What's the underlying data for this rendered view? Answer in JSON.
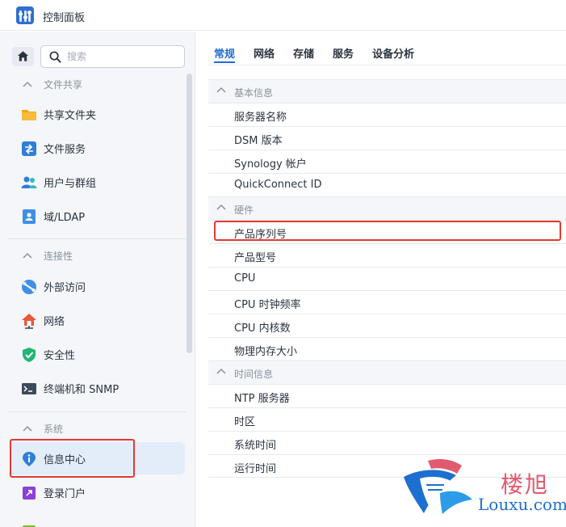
{
  "window": {
    "title": "控制面板"
  },
  "sidebar": {
    "search_placeholder": "搜索",
    "sections": [
      {
        "label": "文件共享"
      },
      {
        "label": "连接性"
      },
      {
        "label": "系统"
      }
    ],
    "items": [
      {
        "label": "共享文件夹",
        "icon": "folder-icon"
      },
      {
        "label": "文件服务",
        "icon": "file-services-icon"
      },
      {
        "label": "用户与群组",
        "icon": "users-icon"
      },
      {
        "label": "域/LDAP",
        "icon": "ldap-icon"
      },
      {
        "label": "外部访问",
        "icon": "external-access-icon"
      },
      {
        "label": "网络",
        "icon": "network-icon"
      },
      {
        "label": "安全性",
        "icon": "shield-icon"
      },
      {
        "label": "终端机和 SNMP",
        "icon": "terminal-icon"
      },
      {
        "label": "信息中心",
        "icon": "info-icon",
        "active": true
      },
      {
        "label": "登录门户",
        "icon": "login-portal-icon"
      }
    ]
  },
  "tabs": [
    {
      "label": "常规",
      "active": true
    },
    {
      "label": "网络"
    },
    {
      "label": "存储"
    },
    {
      "label": "服务"
    },
    {
      "label": "设备分析"
    }
  ],
  "info_table": {
    "groups": [
      {
        "label": "基本信息",
        "rows": [
          "服务器名称",
          "DSM 版本",
          "Synology 帐户",
          "QuickConnect ID"
        ]
      },
      {
        "label": "硬件",
        "rows": [
          "产品序列号",
          "产品型号",
          "CPU",
          "CPU 时钟频率",
          "CPU 内核数",
          "物理内存大小"
        ]
      },
      {
        "label": "时间信息",
        "rows": [
          "NTP 服务器",
          "时区",
          "系统时间",
          "运行时间"
        ]
      }
    ]
  },
  "watermark": {
    "cn": "楼旭",
    "en": "Louxu.com"
  },
  "colors": {
    "accent": "#1f6cd4",
    "highlight_box": "#e03b33",
    "active_item_bg": "#e3ecf9"
  }
}
